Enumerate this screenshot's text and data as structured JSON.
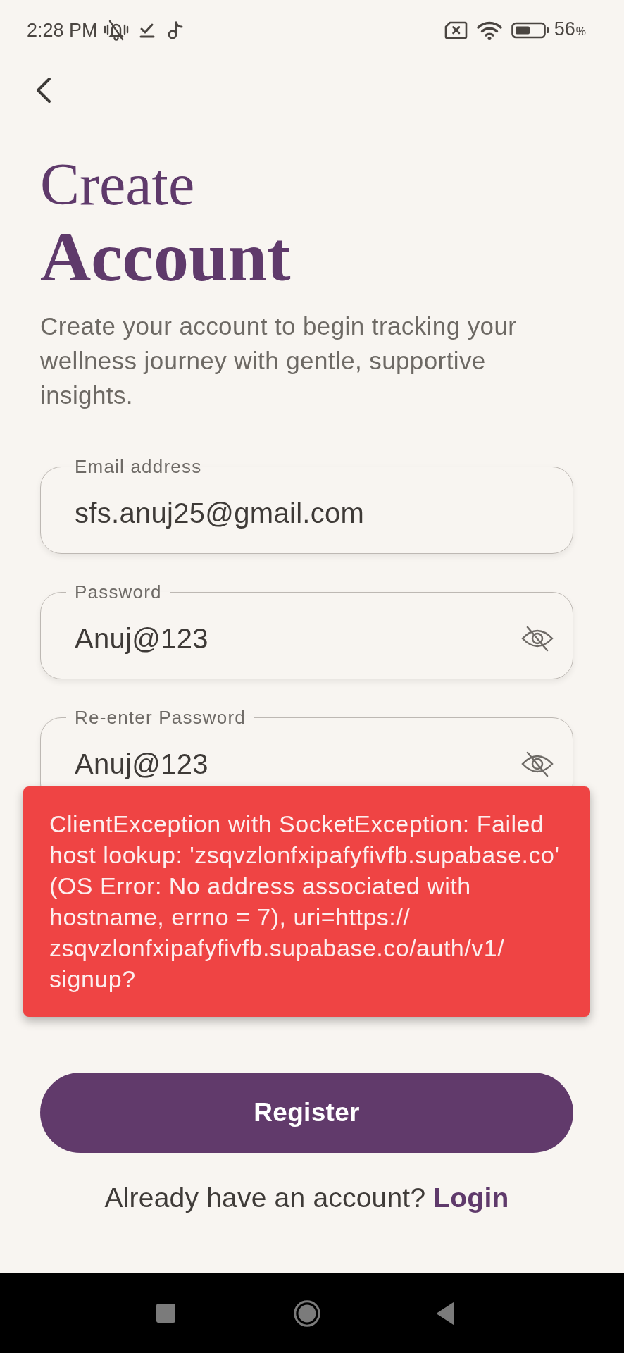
{
  "status_bar": {
    "time": "2:28 PM",
    "battery": {
      "value": "56",
      "unit": "%"
    }
  },
  "header": {
    "title_lines": [
      "Create",
      "Account"
    ],
    "subtitle": "Create your account to begin tracking your wellness journey with gentle, supportive insights."
  },
  "fields": [
    {
      "kind": "email",
      "label": "Email address",
      "value": "sfs.anuj25@gmail.com"
    },
    {
      "kind": "password",
      "label": "Password",
      "value": "Anuj@123",
      "revealed": true
    },
    {
      "kind": "password",
      "label": "Re-enter Password",
      "value": "Anuj@123",
      "revealed": true
    }
  ],
  "error_snackbar": {
    "message": "ClientException with SocketException: Failed host lookup: 'zsqvzlonfxipafyfivfb.supabase.co' (OS Error: No address associated with hostname, errno = 7), uri=https://zsqvzlonfxipafyfivfb.supabase.co/auth/v1/signup?"
  },
  "register_button": {
    "label": "Register"
  },
  "login_prompt": {
    "text": "Already have an account?",
    "link": "Login"
  }
}
